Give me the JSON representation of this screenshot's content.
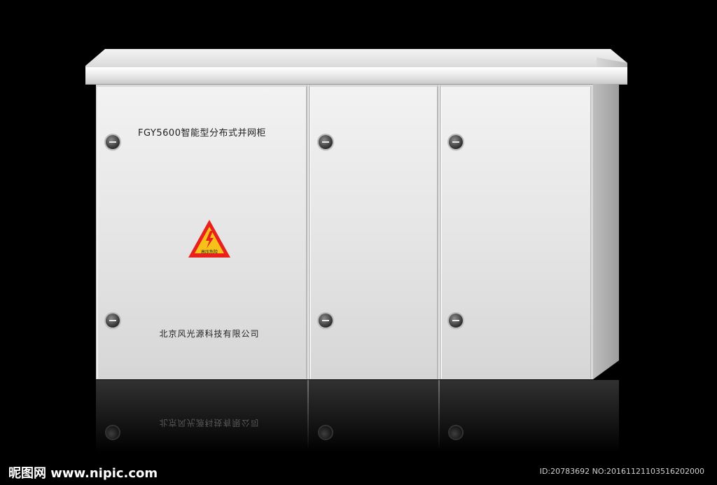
{
  "cabinet": {
    "model_label": "FGY5600智能型分布式并网柜",
    "company_label": "北京风光源科技有限公司",
    "warning_sign": {
      "icon": "high-voltage-icon",
      "text": "高压危险",
      "colors": {
        "triangle": "#e8211d",
        "fill": "#f6c21a"
      }
    }
  },
  "reflection": {
    "company_label": "北京风光源科技有限公司"
  },
  "watermark": {
    "site": "昵图网 www.nipic.com",
    "id_text": "ID:20783692 NO:20161121103516202000"
  },
  "colors": {
    "background": "#000000",
    "cabinet": "#e4e4e4"
  }
}
